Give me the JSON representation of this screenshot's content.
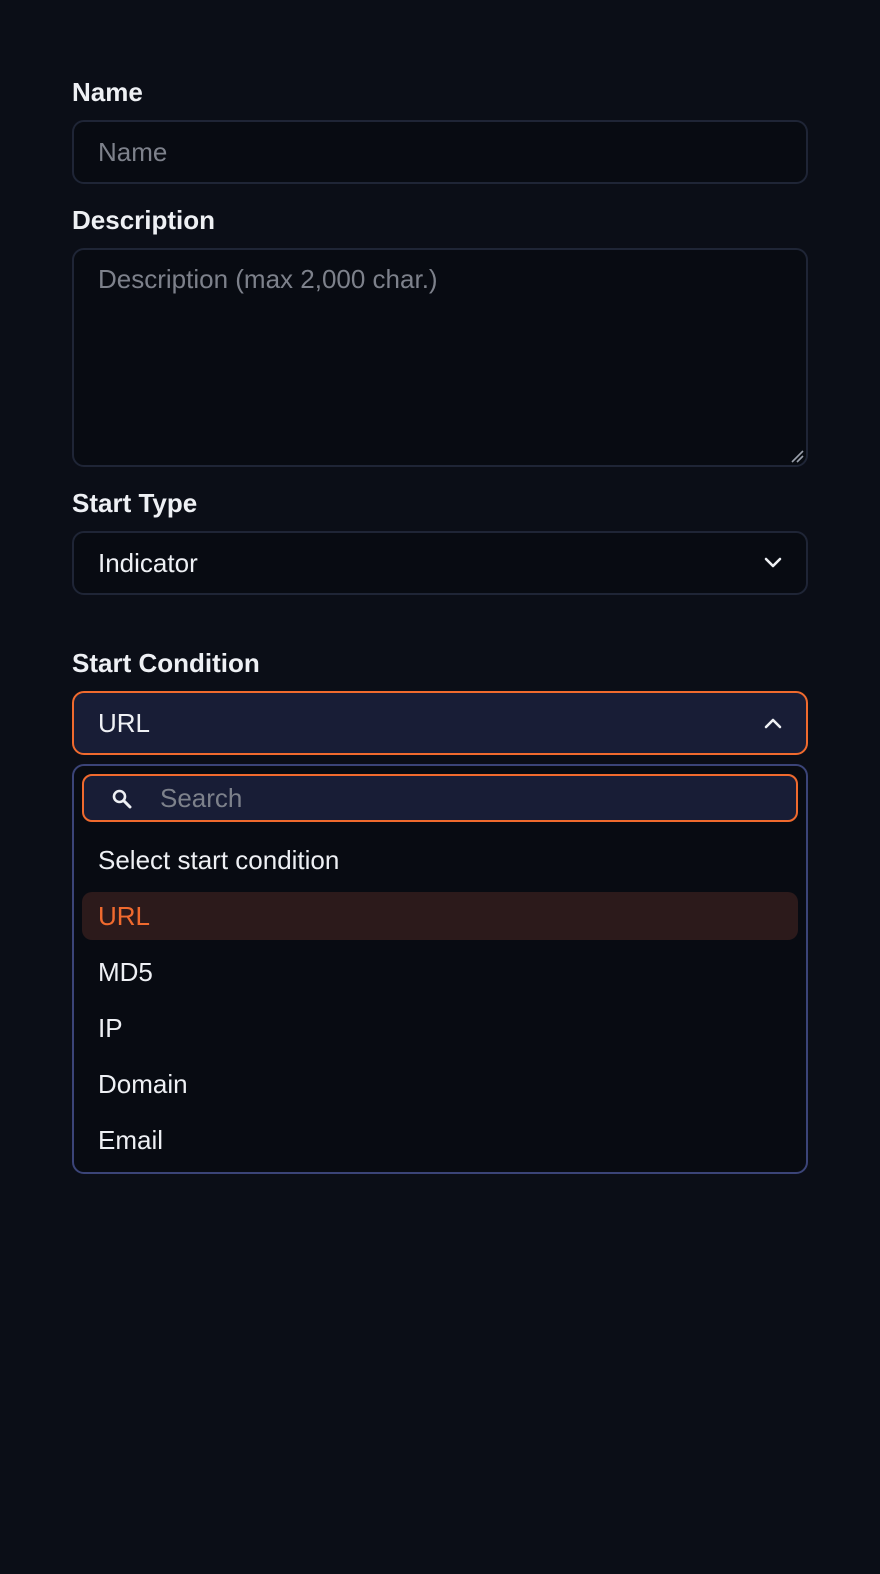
{
  "form": {
    "name": {
      "label": "Name",
      "placeholder": "Name"
    },
    "description": {
      "label": "Description",
      "placeholder": "Description (max 2,000 char.)"
    },
    "start_type": {
      "label": "Start Type",
      "value": "Indicator",
      "icon": "chevron-down-icon"
    },
    "start_condition": {
      "label": "Start Condition",
      "value": "URL",
      "icon": "chevron-up-icon",
      "search_placeholder": "Search",
      "search_icon": "search-icon",
      "options": [
        {
          "label": "Select start condition",
          "selected": false
        },
        {
          "label": "URL",
          "selected": true
        },
        {
          "label": "MD5",
          "selected": false
        },
        {
          "label": "IP",
          "selected": false
        },
        {
          "label": "Domain",
          "selected": false
        },
        {
          "label": "Email",
          "selected": false
        }
      ]
    }
  },
  "colors": {
    "background": "#0b0e17",
    "field_background": "#080b12",
    "field_border": "#1f2536",
    "accent": "#f06a2e",
    "open_select_background": "#181d36",
    "dropdown_border": "#3b4478",
    "selected_option_background": "#2c1a1b",
    "text": "#eef0f4",
    "placeholder": "#7d818b"
  }
}
